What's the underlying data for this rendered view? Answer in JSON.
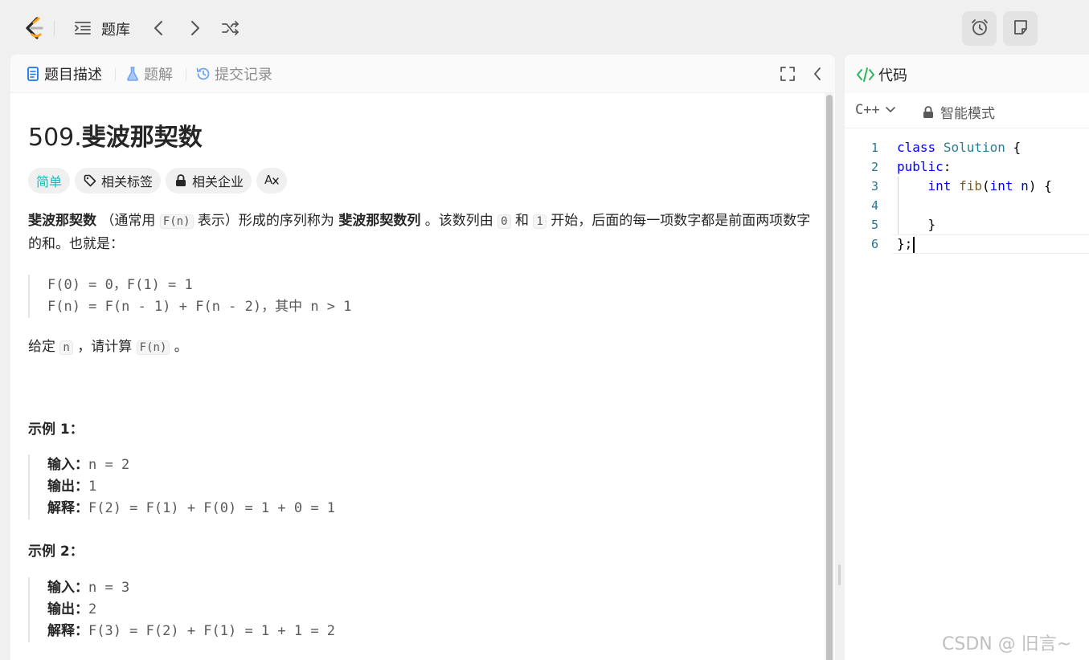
{
  "topbar": {
    "problem_list_label": "题库"
  },
  "tabs": {
    "description": "题目描述",
    "solutions": "题解",
    "submissions": "提交记录"
  },
  "problem": {
    "number": "509.",
    "name": "斐波那契数",
    "difficulty": "简单",
    "tag_topics": "相关标签",
    "tag_companies": "相关企业",
    "intro": {
      "term": "斐波那契数",
      "a1": " （通常用 ",
      "code_fn": "F(n)",
      "a2": " 表示）形成的序列称为 ",
      "term2": "斐波那契数列",
      "a3": " 。该数列由 ",
      "zero": "0",
      "a4": " 和 ",
      "one": "1",
      "a5": " 开始，后面的每一项数字都是前面两项数字的和。也就是："
    },
    "formula_line1": "F(0) = 0，F(1) = 1",
    "formula_line2": "F(n) = F(n - 1) + F(n - 2)，其中 n > 1",
    "ask": {
      "b1": "给定 ",
      "n": "n",
      "b2": " ，请计算 ",
      "fn": "F(n)",
      "b3": " 。"
    },
    "examples": [
      {
        "heading": "示例 1：",
        "input_label": "输入：",
        "input": "n = 2",
        "output_label": "输出：",
        "output": "1",
        "explain_label": "解释：",
        "explain": "F(2) = F(1) + F(0) = 1 + 0 = 1"
      },
      {
        "heading": "示例 2：",
        "input_label": "输入：",
        "input": "n = 3",
        "output_label": "输出：",
        "output": "2",
        "explain_label": "解释：",
        "explain": "F(3) = F(2) + F(1) = 1 + 1 = 2"
      }
    ]
  },
  "editor": {
    "title": "代码",
    "language": "C++",
    "mode": "智能模式",
    "line_numbers": [
      "1",
      "2",
      "3",
      "4",
      "5",
      "6"
    ]
  },
  "watermark": "CSDN @ 旧言~",
  "colors": {
    "easy": "#1cb8b8",
    "code_icon": "#2db55d",
    "logo_orange": "#ffa116"
  }
}
